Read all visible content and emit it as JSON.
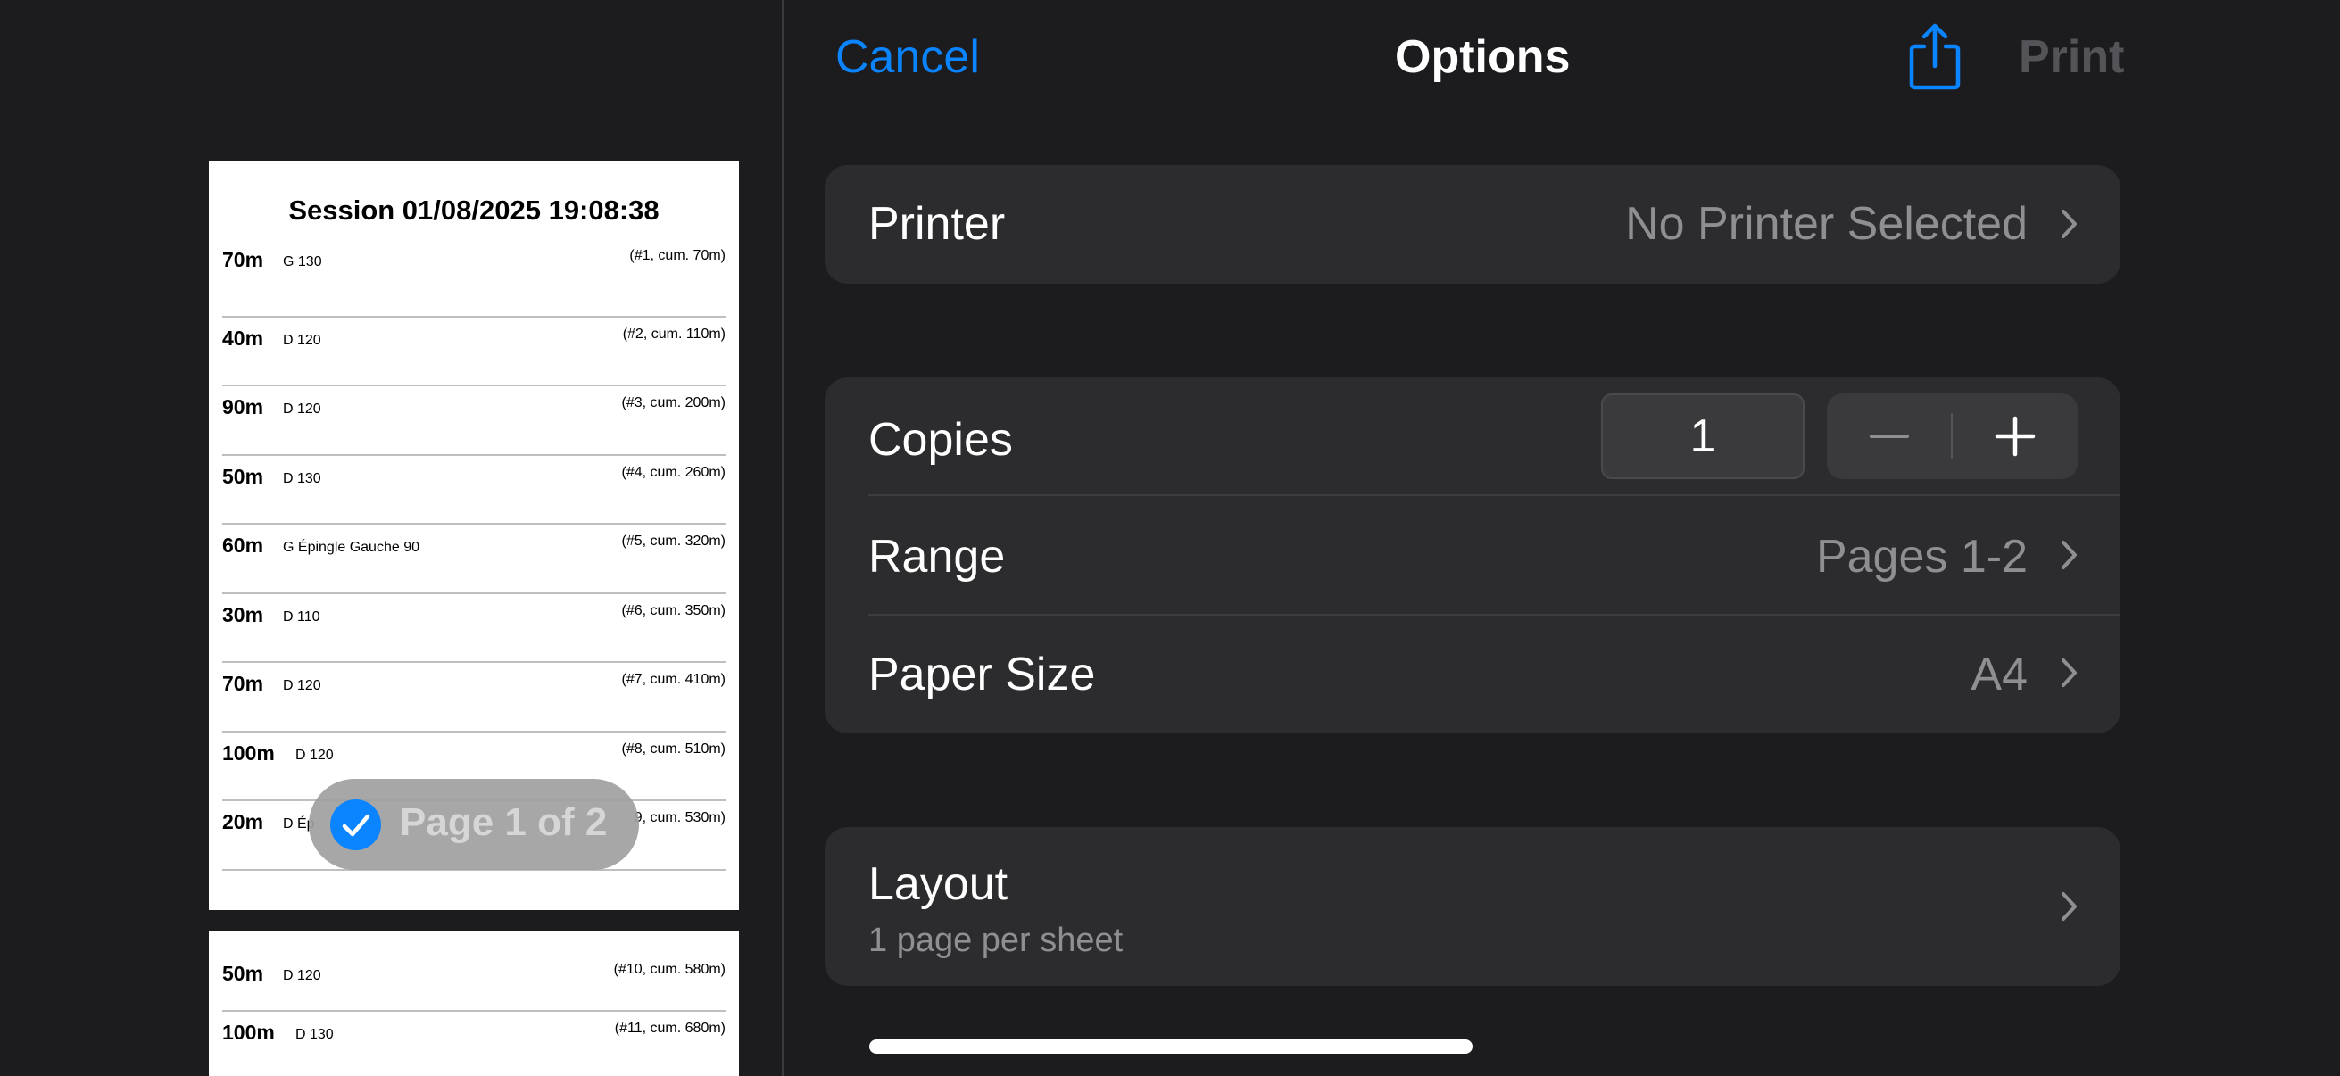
{
  "nav": {
    "cancel_label": "Cancel",
    "title": "Options",
    "share_icon": "share-icon",
    "print_label": "Print"
  },
  "printer": {
    "label": "Printer",
    "value": "No Printer Selected"
  },
  "copies": {
    "label": "Copies",
    "value": "1",
    "decrement": "minus-icon",
    "increment": "plus-icon"
  },
  "range": {
    "label": "Range",
    "value": "Pages 1-2"
  },
  "paper_size": {
    "label": "Paper Size",
    "value": "A4"
  },
  "layout": {
    "label": "Layout",
    "subtitle": "1 page per sheet"
  },
  "preview": {
    "page1": {
      "title": "Session 01/08/2025 19:08:38",
      "rows": [
        {
          "dist": "70m",
          "turn": "G 130",
          "cum": "(#1, cum. 70m)"
        },
        {
          "dist": "40m",
          "turn": "D 120",
          "cum": "(#2, cum. 110m)"
        },
        {
          "dist": "90m",
          "turn": "D 120",
          "cum": "(#3, cum. 200m)"
        },
        {
          "dist": "50m",
          "turn": "D 130",
          "cum": "(#4, cum. 260m)"
        },
        {
          "dist": "60m",
          "turn": "G Épingle Gauche 90",
          "cum": "(#5, cum. 320m)"
        },
        {
          "dist": "30m",
          "turn": "D 110",
          "cum": "(#6, cum. 350m)"
        },
        {
          "dist": "70m",
          "turn": "D 120",
          "cum": "(#7, cum. 410m)"
        },
        {
          "dist": "100m",
          "turn": "D 120",
          "cum": "(#8, cum. 510m)"
        },
        {
          "dist": "20m",
          "turn": "D Ép",
          "cum": "9, cum. 530m)"
        }
      ]
    },
    "page2": {
      "rows": [
        {
          "dist": "50m",
          "turn": "D 120",
          "cum": "(#10, cum. 580m)"
        },
        {
          "dist": "100m",
          "turn": "D 130",
          "cum": "(#11, cum. 680m)"
        }
      ]
    },
    "badge": {
      "label": "Page 1 of 2",
      "check_icon": "checkmark-icon"
    }
  },
  "colors": {
    "background": "#1c1c1e",
    "group_background": "#2c2c2e",
    "accent": "#0a84ff",
    "secondary_text": "#8e8e93",
    "disabled_text": "#545458"
  }
}
